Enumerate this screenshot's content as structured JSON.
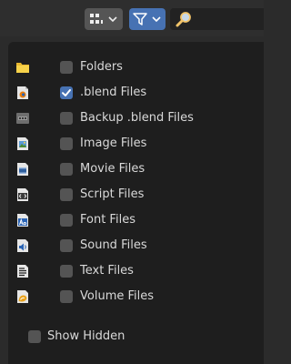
{
  "header": {
    "display_mode_icon": "thumbnail-grid-icon",
    "filter_icon": "funnel-filter-icon",
    "search_icon": "magnifier-icon",
    "accent_color": "#4772b3"
  },
  "filters": [
    {
      "label": "Folders",
      "icon": "folder-icon",
      "checked": false
    },
    {
      "label": ".blend Files",
      "icon": "blend-file-icon",
      "checked": true
    },
    {
      "label": "Backup .blend Files",
      "icon": "backup-file-icon",
      "checked": false
    },
    {
      "label": "Image Files",
      "icon": "image-file-icon",
      "checked": false
    },
    {
      "label": "Movie Files",
      "icon": "movie-file-icon",
      "checked": false
    },
    {
      "label": "Script Files",
      "icon": "script-file-icon",
      "checked": false
    },
    {
      "label": "Font Files",
      "icon": "font-file-icon",
      "checked": false
    },
    {
      "label": "Sound Files",
      "icon": "sound-file-icon",
      "checked": false
    },
    {
      "label": "Text Files",
      "icon": "text-file-icon",
      "checked": false
    },
    {
      "label": "Volume Files",
      "icon": "volume-file-icon",
      "checked": false
    }
  ],
  "show_hidden": {
    "label": "Show Hidden",
    "checked": false
  }
}
